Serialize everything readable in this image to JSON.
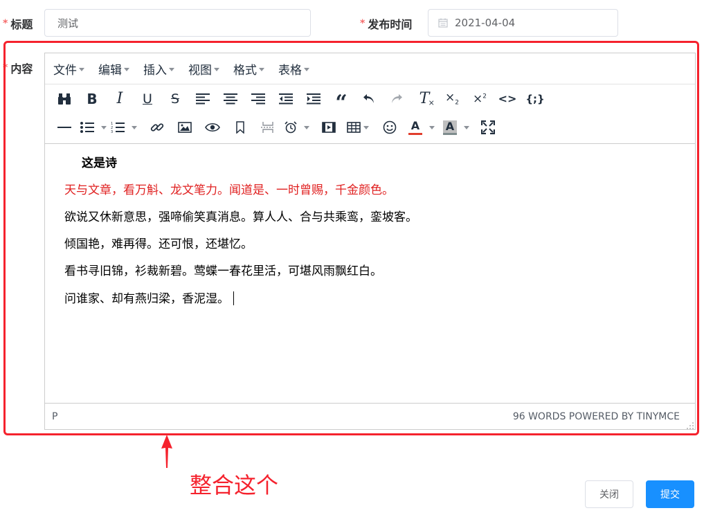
{
  "form": {
    "title_label": "标题",
    "title_value": "测试",
    "publish_label": "发布时间",
    "publish_value": "2021-04-04",
    "content_label": "内容",
    "required_mark": "*"
  },
  "editor": {
    "menus": [
      "文件",
      "编辑",
      "插入",
      "视图",
      "格式",
      "表格"
    ],
    "content": {
      "title": "这是诗",
      "lines": [
        "天与文章，看万斛、龙文笔力。闻道是、一时曾赐，千金颜色。",
        "欲说又休新意思，强啼偷笑真消息。算人人、合与共乘鸾，銮坡客。",
        "倾国艳，难再得。还可恨，还堪忆。",
        "看书寻旧锦，衫裁新碧。莺蝶一春花里活，可堪风雨飘红白。",
        "问谁家、却有燕归梁，香泥湿。"
      ],
      "highlight_color": "#e02020"
    },
    "status_path": "P",
    "status_right": "96 WORDS POWERED BY TINYMCE"
  },
  "annotation": {
    "text": "整合这个",
    "color": "#f5222d"
  },
  "buttons": {
    "close": "关闭",
    "submit": "提交"
  },
  "colors": {
    "primary": "#1890ff",
    "required": "#f56c6c"
  }
}
